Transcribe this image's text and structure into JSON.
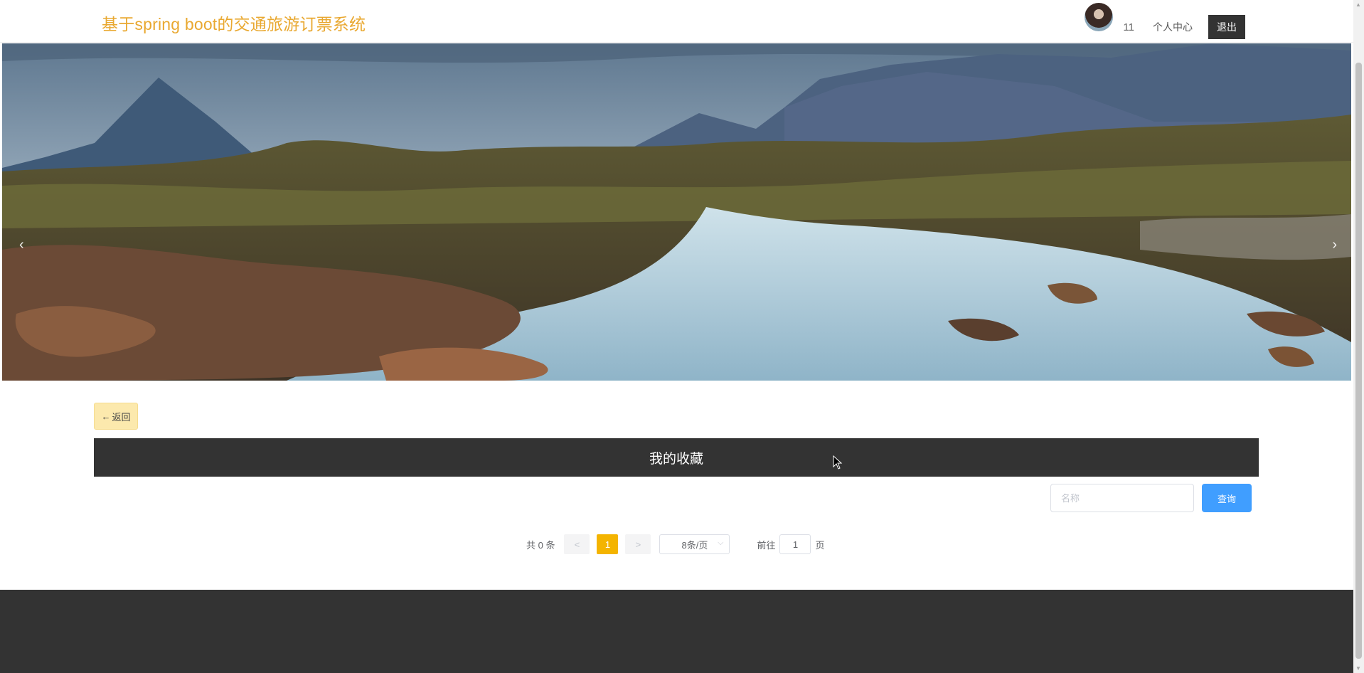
{
  "header": {
    "site_title": "基于spring boot的交通旅游订票系统",
    "username": "11",
    "profile_label": "个人中心",
    "logout_label": "退出"
  },
  "banner": {
    "prev_icon": "‹",
    "next_icon": "›",
    "slide_count": 3,
    "active_slide": 1
  },
  "back_button": {
    "label": "返回",
    "icon": "arrow-left-icon"
  },
  "section": {
    "title": "我的收藏"
  },
  "search": {
    "placeholder": "名称",
    "value": "",
    "button_label": "查询"
  },
  "pagination": {
    "total_label": "共 0 条",
    "prev": "<",
    "current_page": "1",
    "next": ">",
    "page_size": "8条/页",
    "goto_prefix": "前往",
    "goto_value": "1",
    "goto_suffix": "页"
  },
  "colors": {
    "title": "#e9a830",
    "dark": "#333333",
    "back_button_bg": "#fce9ad",
    "primary": "#409eff",
    "active_page": "#f4b400"
  }
}
